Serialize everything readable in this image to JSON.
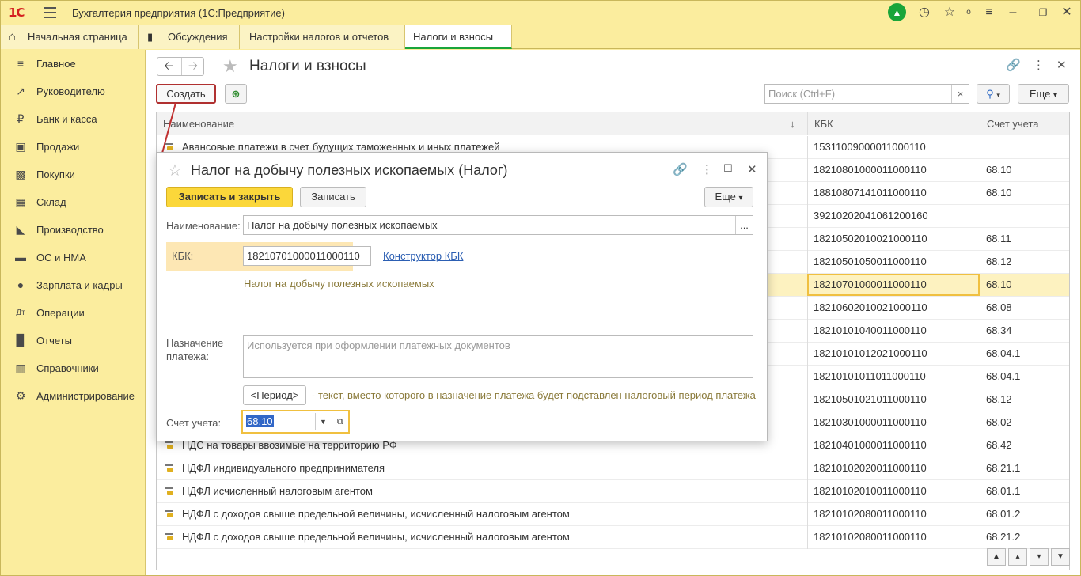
{
  "app": {
    "logo": "1С",
    "title": "Бухгалтерия предприятия  (1С:Предприятие)"
  },
  "tabs": [
    {
      "label": "Начальная страница"
    },
    {
      "label": "Обсуждения"
    },
    {
      "label": "Настройки налогов и отчетов"
    },
    {
      "label": "Налоги и взносы"
    }
  ],
  "sidebar": {
    "items": [
      {
        "label": "Главное",
        "icon": "menu-icon"
      },
      {
        "label": "Руководителю",
        "icon": "trend-icon"
      },
      {
        "label": "Банк и касса",
        "icon": "ruble-icon"
      },
      {
        "label": "Продажи",
        "icon": "bag-icon"
      },
      {
        "label": "Покупки",
        "icon": "cart-icon"
      },
      {
        "label": "Склад",
        "icon": "warehouse-icon"
      },
      {
        "label": "Производство",
        "icon": "factory-icon"
      },
      {
        "label": "ОС и НМА",
        "icon": "truck-icon"
      },
      {
        "label": "Зарплата и кадры",
        "icon": "person-icon"
      },
      {
        "label": "Операции",
        "icon": "operations-icon"
      },
      {
        "label": "Отчеты",
        "icon": "chart-icon"
      },
      {
        "label": "Справочники",
        "icon": "book-icon"
      },
      {
        "label": "Администрирование",
        "icon": "gear-icon"
      }
    ]
  },
  "page": {
    "title": "Налоги и взносы",
    "create_label": "Создать",
    "search_placeholder": "Поиск (Ctrl+F)",
    "more_label": "Еще",
    "more_arrow": "▾"
  },
  "list": {
    "columns": [
      "Наименование",
      "КБК",
      "Счет учета"
    ],
    "rows": [
      {
        "name": "Авансовые платежи в счет будущих таможенных и иных платежей",
        "kbk": "15311009000011000110",
        "account": ""
      },
      {
        "name": "",
        "kbk": "18210801000011000110",
        "account": "68.10"
      },
      {
        "name": "",
        "kbk": "18810807141011000110",
        "account": "68.10"
      },
      {
        "name": "",
        "kbk": "39210202041061200160",
        "account": ""
      },
      {
        "name": "",
        "kbk": "18210502010021000110",
        "account": "68.11"
      },
      {
        "name": "",
        "kbk": "18210501050011000110",
        "account": "68.12"
      },
      {
        "name": "",
        "kbk": "18210701000011000110",
        "account": "68.10"
      },
      {
        "name": "",
        "kbk": "18210602010021000110",
        "account": "68.08"
      },
      {
        "name": "",
        "kbk": "18210101040011000110",
        "account": "68.34"
      },
      {
        "name": "",
        "kbk": "18210101012021000110",
        "account": "68.04.1"
      },
      {
        "name": "",
        "kbk": "18210101011011000110",
        "account": "68.04.1"
      },
      {
        "name": "",
        "kbk": "18210501021011000110",
        "account": "68.12"
      },
      {
        "name": "",
        "kbk": "18210301000011000110",
        "account": "68.02"
      },
      {
        "name": "НДС на товары ввозимые на территорию РФ",
        "kbk": "18210401000011000110",
        "account": "68.42"
      },
      {
        "name": "НДФЛ индивидуального предпринимателя",
        "kbk": "18210102020011000110",
        "account": "68.21.1"
      },
      {
        "name": "НДФЛ исчисленный налоговым агентом",
        "kbk": "18210102010011000110",
        "account": "68.01.1"
      },
      {
        "name": "НДФЛ с доходов свыше предельной величины, исчисленный налоговым агентом",
        "kbk": "18210102080011000110",
        "account": "68.01.2"
      },
      {
        "name": "НДФЛ с доходов свыше предельной величины, исчисленный налоговым агентом",
        "kbk": "18210102080011000110",
        "account": "68.21.2"
      }
    ]
  },
  "dialog": {
    "title": "Налог на добычу полезных ископаемых (Налог)",
    "save_close_label": "Записать и закрыть",
    "save_label": "Записать",
    "more_label": "Еще",
    "more_arrow": "▾",
    "name_label": "Наименование:",
    "name_value": "Налог на добычу полезных ископаемых",
    "name_select": "...",
    "kbk_label": "КБК:",
    "kbk_value": "18210701000011000110",
    "kbk_constructor_link": "Конструктор КБК",
    "kbk_description": "Налог на добычу полезных ископаемых",
    "purpose_label_1": "Назначение",
    "purpose_label_2": "платежа:",
    "purpose_placeholder": "Используется при оформлении платежных документов",
    "period_button": "<Период>",
    "period_hint": "- текст, вместо которого в назначение платежа будет подставлен налоговый период платежа",
    "account_label": "Счет учета:",
    "account_value": "68.10"
  },
  "colors": {
    "accent_yellow": "#fbed9e",
    "save_button": "#fbd73a",
    "link": "#2c5fb3",
    "highlight_row": "#fdf2c0",
    "create_border": "#b03030"
  }
}
